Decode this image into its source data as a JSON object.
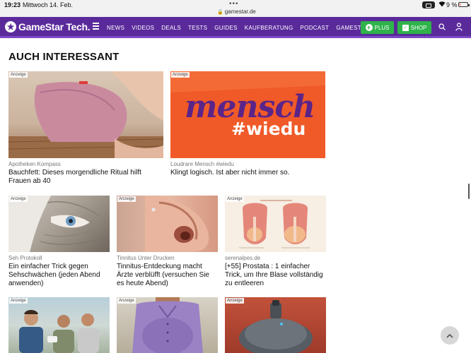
{
  "status_bar": {
    "time": "19:23",
    "date": "Mittwoch 14. Feb.",
    "dots": "•••",
    "url": "gamestar.de",
    "battery": "9 %"
  },
  "nav": {
    "logo": "GameStar Tech.",
    "links": [
      "NEWS",
      "VIDEOS",
      "DEALS",
      "TESTS",
      "GUIDES",
      "KAUFBERATUNG",
      "PODCAST",
      "GAMESTAR.DE"
    ],
    "plus_label": "PLUS",
    "shop_label": "SHOP",
    "brand_color": "#5a2a9b",
    "button_color": "#2fb34a"
  },
  "section_title": "AUCH INTERESSANT",
  "ad_badge": "Anzeige",
  "cards": [
    {
      "source": "Apotheken Kompass",
      "title": "Bauchfett: Dieses morgendliche Ritual hilft Frauen ab 40"
    },
    {
      "source": "Loudrare Mensch #wiedu",
      "title": "Klingt logisch. Ist aber nicht immer so.",
      "image_text_1": "mensch",
      "image_text_2": "#wiedu"
    },
    {
      "source": "Seh Protokoll",
      "title": "Ein einfacher Trick gegen Sehschwächen (jeden Abend anwenden)"
    },
    {
      "source": "Tinnitus Unter Drucken",
      "title": "Tinnitus-Entdeckung macht Ärzte verblüfft (versuchen Sie es heute Abend)"
    },
    {
      "source": "serenalpes.de",
      "title": "[+55] Prostata : 1 einfacher Trick, um Ihre Blase vollständig zu entleeren"
    },
    {
      "source": "",
      "title": ""
    },
    {
      "source": "",
      "title": ""
    },
    {
      "source": "",
      "title": ""
    }
  ]
}
